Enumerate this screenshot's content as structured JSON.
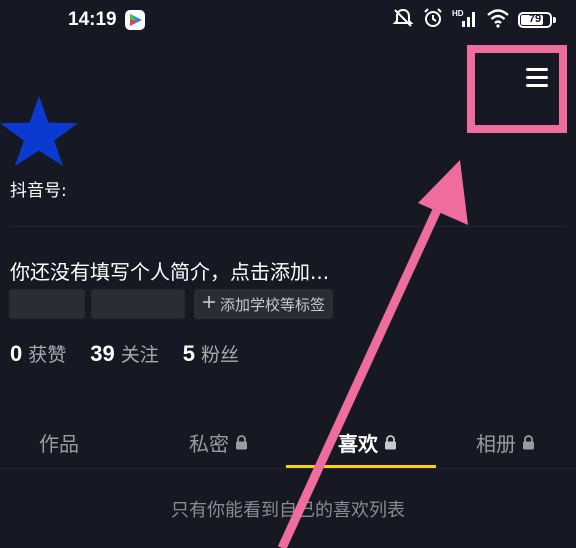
{
  "status_bar": {
    "time": "14:19",
    "battery": "79",
    "battery_level": 0.79,
    "icons": [
      "app-store-icon",
      "mute-icon",
      "alarm-icon",
      "hd-icon",
      "signal-icon",
      "wifi-icon",
      "battery-icon"
    ]
  },
  "profile": {
    "douyin_id_label": "抖音号:",
    "bio": "你还没有填写个人简介，点击添加...",
    "add_tag_label": "添加学校等标签",
    "avatar_icon": "star-icon",
    "avatar_color": "#0b3ad1"
  },
  "stats": [
    {
      "value": "0",
      "label": "获赞"
    },
    {
      "value": "39",
      "label": "关注"
    },
    {
      "value": "5",
      "label": "粉丝"
    }
  ],
  "tabs": [
    {
      "label": "作品",
      "locked": false,
      "active": false
    },
    {
      "label": "私密",
      "locked": true,
      "active": false
    },
    {
      "label": "喜欢",
      "locked": true,
      "active": true
    },
    {
      "label": "相册",
      "locked": true,
      "active": false
    }
  ],
  "empty_note": "只有你能看到自己的喜欢列表",
  "colors": {
    "background": "#161823",
    "highlight": "#ef6d9c",
    "tab_indicator": "#face15"
  }
}
